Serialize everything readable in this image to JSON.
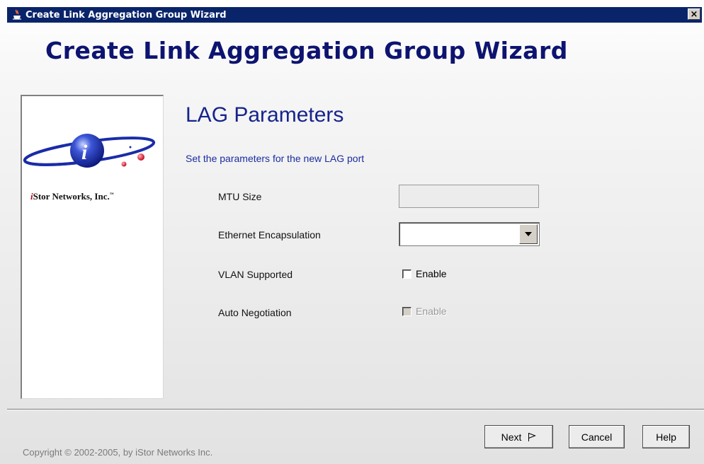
{
  "window": {
    "title": "Create Link Aggregation Group Wizard",
    "close_label": "×"
  },
  "header": {
    "wizard_title": "Create Link Aggregation Group Wizard"
  },
  "sidebar": {
    "company_prefix": "i",
    "company_name": "Stor Networks, Inc.",
    "trademark": "™"
  },
  "step": {
    "title": "LAG Parameters",
    "description": "Set the parameters for the new LAG port"
  },
  "form": {
    "mtu_label": "MTU Size",
    "mtu_value": "",
    "encapsulation_label": "Ethernet Encapsulation",
    "encapsulation_value": "",
    "vlan_label": "VLAN Supported",
    "vlan_checkbox_label": "Enable",
    "vlan_checked": false,
    "auto_neg_label": "Auto Negotiation",
    "auto_neg_checkbox_label": "Enable",
    "auto_neg_checked": false,
    "auto_neg_disabled": true
  },
  "footer": {
    "copyright": "Copyright © 2002-2005, by iStor Networks Inc.",
    "next_label": "Next",
    "cancel_label": "Cancel",
    "help_label": "Help"
  },
  "icons": {
    "title_icon": "java-cup-icon",
    "next_icon": "flag-icon",
    "dropdown_icon": "triangle-down-icon"
  },
  "colors": {
    "titlebar": "#0a246a",
    "wizard_title": "#0d1470",
    "step_title": "#16248c",
    "description": "#1a2ca0"
  }
}
